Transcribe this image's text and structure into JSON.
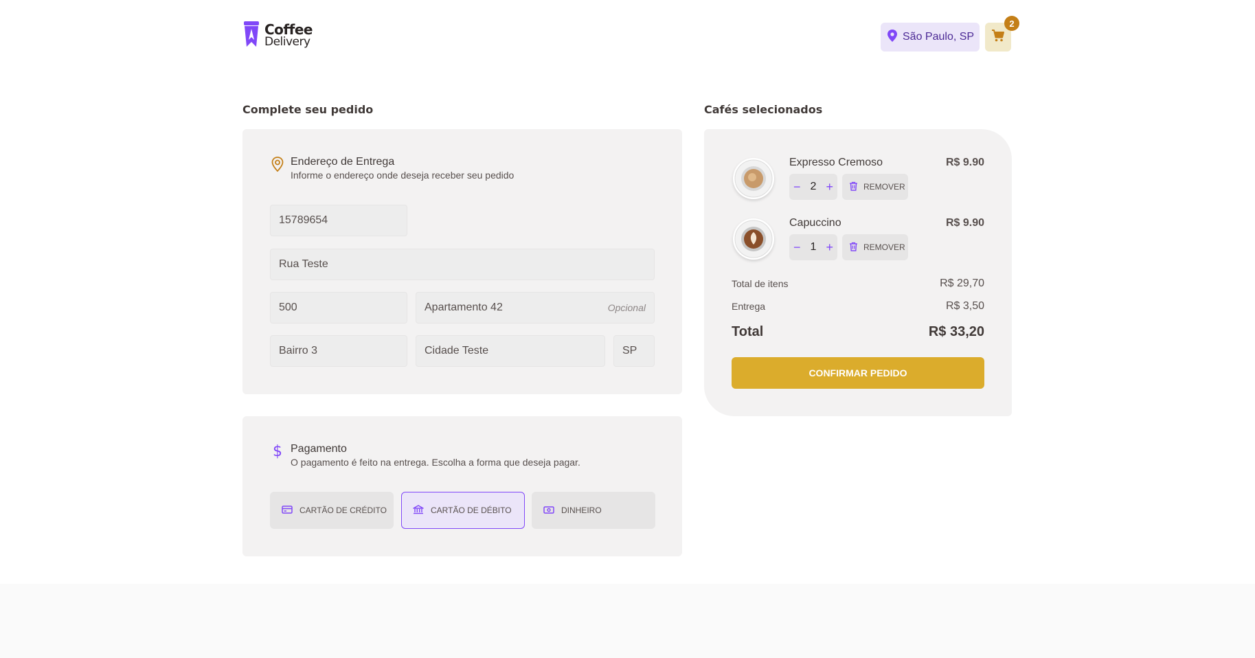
{
  "brand": {
    "line1": "Coffee",
    "line2": "Delivery"
  },
  "header": {
    "location": "São Paulo, SP",
    "cart_count": "2"
  },
  "order_form": {
    "title": "Complete seu pedido",
    "address": {
      "heading": "Endereço de Entrega",
      "subheading": "Informe o endereço onde deseja receber seu pedido",
      "cep": "15789654",
      "street": "Rua Teste",
      "number": "500",
      "complement": "Apartamento 42",
      "complement_hint": "Opcional",
      "district": "Bairro 3",
      "city": "Cidade Teste",
      "uf": "SP"
    },
    "payment": {
      "heading": "Pagamento",
      "subheading": "O pagamento é feito na entrega. Escolha a forma que deseja pagar.",
      "options": [
        "CARTÃO DE CRÉDITO",
        "CARTÃO DE DÉBITO",
        "DINHEIRO"
      ],
      "selected": "CARTÃO DE DÉBITO"
    }
  },
  "cart": {
    "title": "Cafés selecionados",
    "items": [
      {
        "name": "Expresso Cremoso",
        "price": "R$ 9.90",
        "qty": "2",
        "remove_label": "REMOVER"
      },
      {
        "name": "Capuccino",
        "price": "R$ 9.90",
        "qty": "1",
        "remove_label": "REMOVER"
      }
    ],
    "summary": {
      "items_label": "Total de itens",
      "items_value": "R$ 29,70",
      "delivery_label": "Entrega",
      "delivery_value": "R$ 3,50",
      "total_label": "Total",
      "total_value": "R$ 33,20"
    },
    "confirm_label": "CONFIRMAR PEDIDO"
  },
  "colors": {
    "purple": "#8047f8",
    "purple_dark": "#4b2995",
    "yellow": "#dbac2c",
    "yellow_dark": "#c47f17"
  }
}
